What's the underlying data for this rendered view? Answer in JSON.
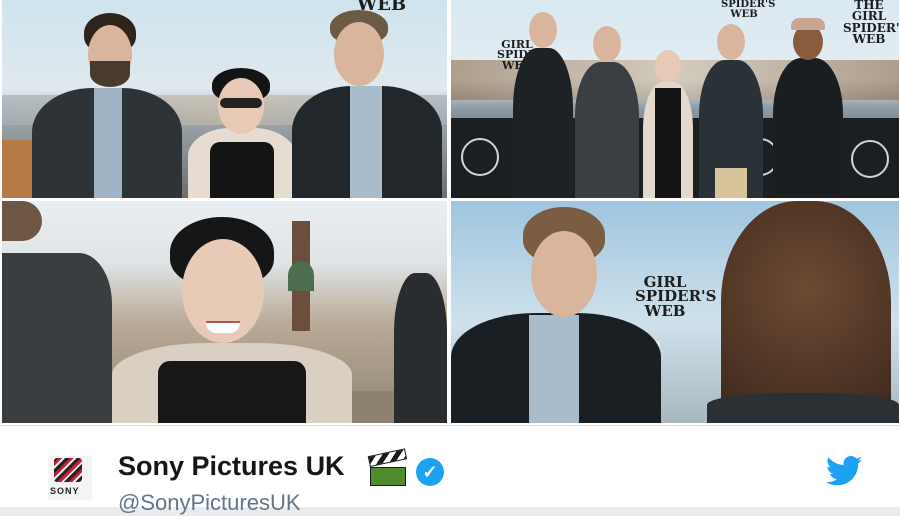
{
  "photos": {
    "photo1": {
      "sign_text": "WEB"
    },
    "photo2": {
      "sign_text_left": "GIRL SPIDER'S WEB",
      "sign_text_mid": "SPIDER'S WEB",
      "sign_text_right": "THE GIRL SPIDER'S WEB"
    },
    "photo4": {
      "sign_text": "GIRL SPIDER'S WEB"
    }
  },
  "tweet": {
    "author_name": "Sony Pictures UK",
    "handle": "@SonyPicturesUK",
    "avatar_text": "SONY",
    "icons": [
      "clapper-board-icon",
      "verified-badge-icon",
      "twitter-bird-icon"
    ]
  },
  "colors": {
    "verified_blue": "#1da1f2",
    "name_text": "#14171a",
    "handle_text": "#657786"
  }
}
